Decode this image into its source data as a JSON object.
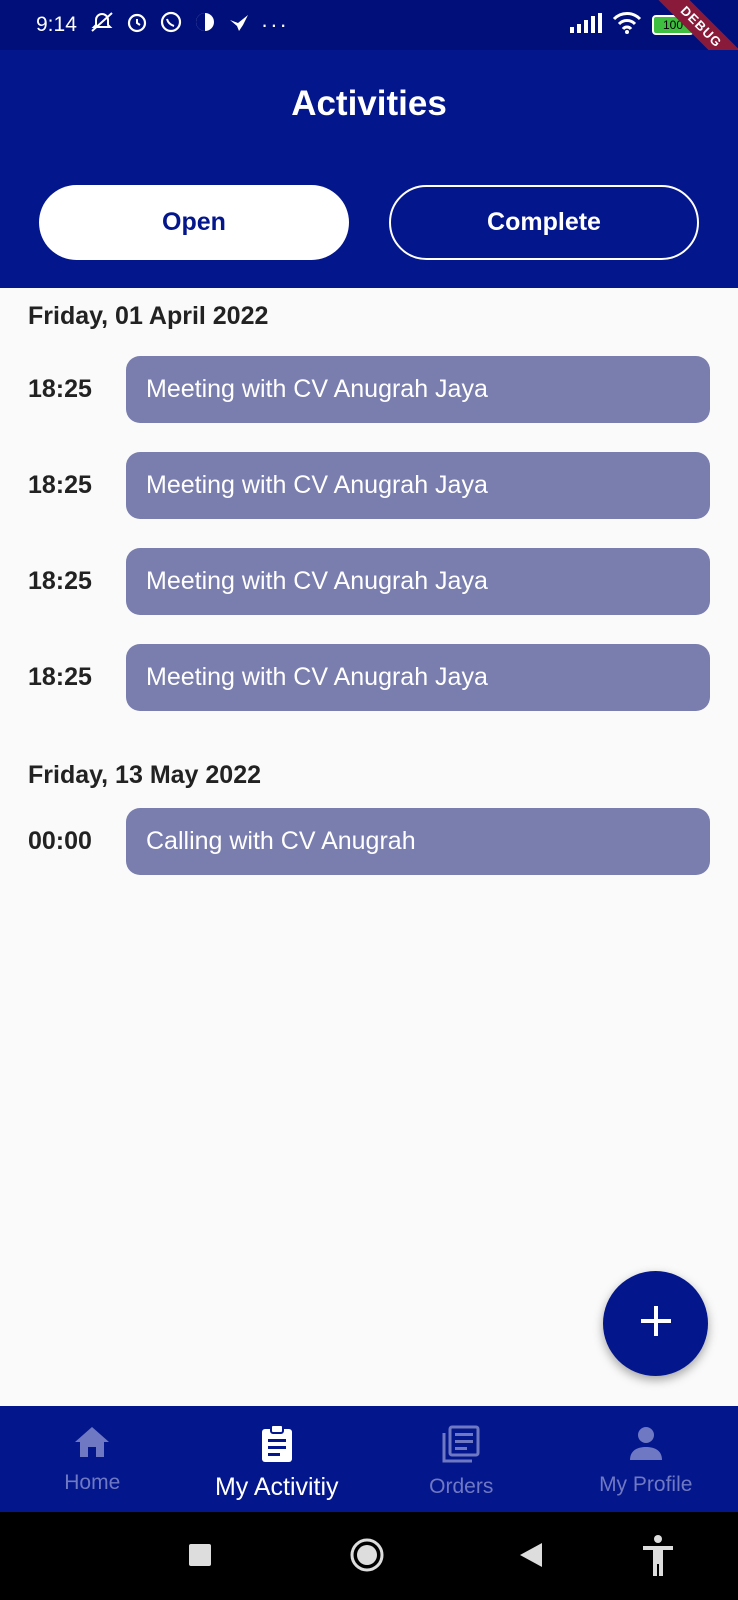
{
  "status_bar": {
    "time": "9:14",
    "more": "···",
    "battery": "100",
    "debug_label": "DEBUG"
  },
  "header": {
    "title": "Activities",
    "tabs": [
      {
        "label": "Open",
        "selected": true
      },
      {
        "label": "Complete",
        "selected": false
      }
    ]
  },
  "groups": [
    {
      "date": "Friday, 01 April 2022",
      "items": [
        {
          "time": "18:25",
          "title": "Meeting with CV Anugrah Jaya"
        },
        {
          "time": "18:25",
          "title": "Meeting with CV Anugrah Jaya"
        },
        {
          "time": "18:25",
          "title": "Meeting with CV Anugrah Jaya"
        },
        {
          "time": "18:25",
          "title": "Meeting with CV Anugrah Jaya"
        }
      ]
    },
    {
      "date": "Friday, 13 May 2022",
      "items": [
        {
          "time": "00:00",
          "title": "Calling with CV Anugrah"
        }
      ]
    }
  ],
  "fab": {
    "icon": "plus-icon"
  },
  "bottom_nav": {
    "items": [
      {
        "label": "Home",
        "icon": "home-icon",
        "active": false
      },
      {
        "label": "My Activitiy",
        "icon": "clipboard-icon",
        "active": true
      },
      {
        "label": "Orders",
        "icon": "orders-icon",
        "active": false
      },
      {
        "label": "My Profile",
        "icon": "person-icon",
        "active": false
      }
    ]
  },
  "colors": {
    "primary": "#03168c",
    "card": "#7a7eae",
    "background": "#fafafa",
    "inactive_nav": "#6f78c2"
  }
}
